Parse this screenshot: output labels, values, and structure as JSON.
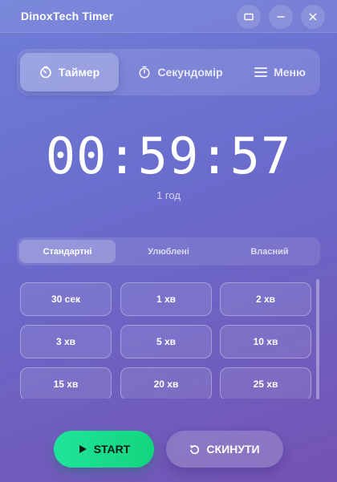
{
  "window": {
    "title": "DinoxTech Timer",
    "controls": [
      "maximize",
      "minimize",
      "close"
    ]
  },
  "nav": {
    "tabs": [
      {
        "label": "Таймер",
        "icon": "timer-icon",
        "active": true
      },
      {
        "label": "Секундомір",
        "icon": "stopwatch-icon",
        "active": false
      },
      {
        "label": "Меню",
        "icon": "menu-icon",
        "active": false
      }
    ]
  },
  "timer": {
    "display": "00:59:57",
    "subtitle": "1 год"
  },
  "preset_tabs": [
    {
      "label": "Стандартні",
      "active": true
    },
    {
      "label": "Улюблені",
      "active": false
    },
    {
      "label": "Власний",
      "active": false
    }
  ],
  "presets": [
    "30 сек",
    "1 хв",
    "2 хв",
    "3 хв",
    "5 хв",
    "10 хв",
    "15 хв",
    "20 хв",
    "25 хв"
  ],
  "actions": {
    "start_label": "START",
    "start_icon": "play-icon",
    "reset_label": "СКИНУТИ",
    "reset_icon": "reset-icon"
  },
  "colors": {
    "start": "#1fe39a",
    "background_top": "#6f7fd8",
    "background_bottom": "#7453b3"
  }
}
